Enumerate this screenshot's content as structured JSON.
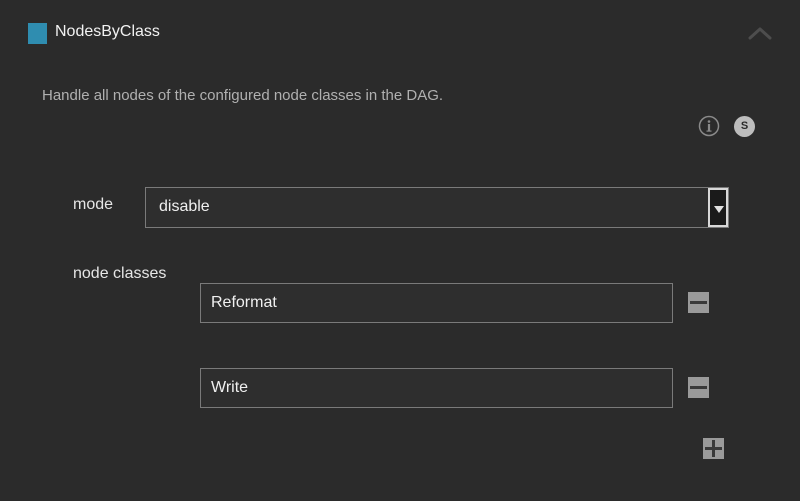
{
  "header": {
    "title": "NodesByClass",
    "swatch_color": "#2f8db0",
    "collapse_icon": "chevron-up-icon"
  },
  "description": "Handle all nodes of the configured node classes in the DAG.",
  "toolbar": {
    "info_icon": "info-icon",
    "s_label": "S"
  },
  "mode": {
    "label": "mode",
    "value": "disable"
  },
  "node_classes": {
    "label": "node classes",
    "items": [
      {
        "value": "Reformat"
      },
      {
        "value": "Write"
      }
    ],
    "remove_icon": "minus-icon",
    "add_icon": "plus-icon"
  }
}
